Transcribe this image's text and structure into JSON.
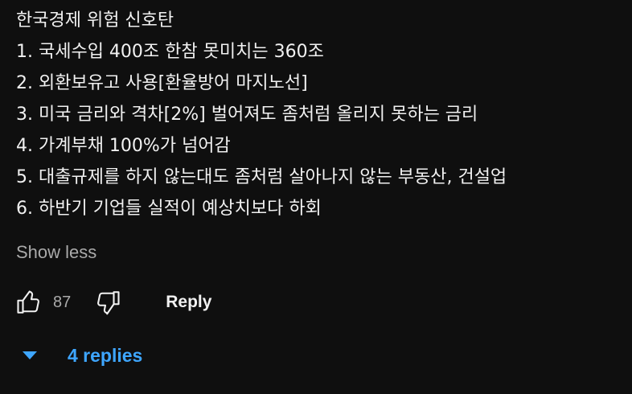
{
  "comment": {
    "lines": [
      "한국경제 위험 신호탄",
      "1. 국세수입 400조 한참 못미치는 360조",
      "2. 외환보유고 사용[환율방어 마지노선]",
      "3. 미국 금리와 격차[2%] 벌어져도 좀처럼 올리지 못하는 금리",
      "4. 가계부채 100%가 넘어감",
      "5. 대출규제를 하지 않는대도 좀처럼 살아나지 않는 부동산, 건설업",
      "6. 하반기 기업들 실적이 예상치보다 하회"
    ],
    "show_less_label": "Show less"
  },
  "actions": {
    "like_count": "87",
    "like_icon": "thumbs-up-icon",
    "dislike_icon": "thumbs-down-icon",
    "reply_label": "Reply"
  },
  "replies": {
    "toggle_icon": "caret-down-icon",
    "label": "4 replies"
  },
  "colors": {
    "background": "#0f0f0f",
    "text": "#f1f1f1",
    "secondary_text": "#aaaaaa",
    "link": "#3ea6ff"
  }
}
